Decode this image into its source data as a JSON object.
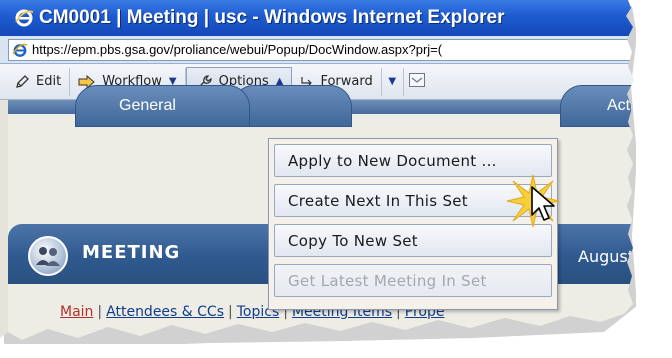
{
  "window": {
    "title": "CM0001 | Meeting | usc - Windows Internet Explorer"
  },
  "address_bar": {
    "url": "https://epm.pbs.gsa.gov/proliance/webui/Popup/DocWindow.aspx?prj=("
  },
  "toolbar": {
    "edit_label": "Edit",
    "workflow_label": "Workflow",
    "options_label": "Options",
    "forward_label": "Forward",
    "icons": [
      "pencil-icon",
      "arrow-right-icon",
      "wrench-icon",
      "forward-arrow-icon",
      "chevron-down-icon",
      "mail-icon"
    ]
  },
  "options_menu": {
    "items": [
      {
        "label": "Apply to New Document ...",
        "enabled": true
      },
      {
        "label": "Create Next In This Set",
        "enabled": true
      },
      {
        "label": "Copy To New Set",
        "enabled": true
      },
      {
        "label": "Get Latest Meeting In Set",
        "enabled": false
      }
    ]
  },
  "tabs": {
    "general": "General",
    "activity": "Activi"
  },
  "header": {
    "title": "MEETING",
    "date_fragment": "August"
  },
  "links": {
    "main": "Main",
    "attendees": "Attendees & CCs",
    "topics": "Topics",
    "meeting_items": "Meeting Items",
    "properties": "Prope",
    "separator": "|"
  },
  "colors": {
    "title_bar": "#1d5bd0",
    "header_band": "#2f5a90",
    "link": "#123c8c",
    "current_link": "#b1322b",
    "disabled_text": "#a3a8b0"
  }
}
